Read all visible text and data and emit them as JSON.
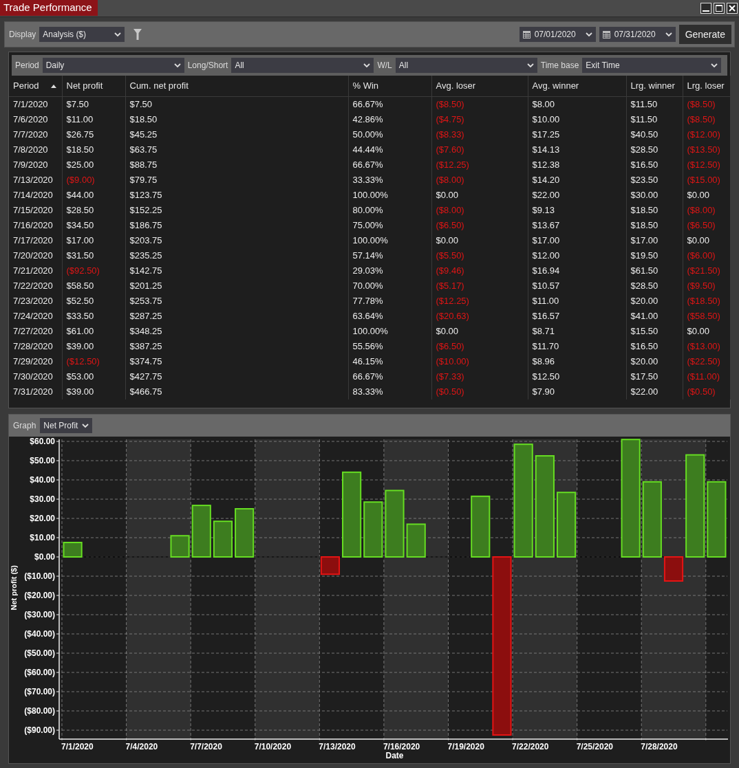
{
  "window": {
    "title": "Trade Performance"
  },
  "toolbar": {
    "display_label": "Display",
    "display_value": "Analysis ($)",
    "start_date": "07/01/2020",
    "end_date": "07/31/2020",
    "generate": "Generate"
  },
  "filters": [
    {
      "label": "Period",
      "value": "Daily"
    },
    {
      "label": "Long/Short",
      "value": "All"
    },
    {
      "label": "W/L",
      "value": "All"
    },
    {
      "label": "Time base",
      "value": "Exit Time"
    }
  ],
  "table": {
    "columns": [
      {
        "label": "Period",
        "sorted": true
      },
      {
        "label": "Net profit",
        "sorted": false
      },
      {
        "label": "Cum. net profit",
        "sorted": false
      },
      {
        "label": "% Win",
        "sorted": false
      },
      {
        "label": "Avg. loser",
        "sorted": false
      },
      {
        "label": "Avg. winner",
        "sorted": false
      },
      {
        "label": "Lrg. winner",
        "sorted": false
      },
      {
        "label": "Lrg. loser",
        "sorted": false
      }
    ],
    "rows": [
      {
        "cells": [
          "7/1/2020",
          "$7.50",
          "$7.50",
          "66.67%",
          "($8.50)",
          "$8.00",
          "$11.50",
          "($8.50)"
        ],
        "negative": [
          false,
          false,
          false,
          false,
          true,
          false,
          false,
          true
        ]
      },
      {
        "cells": [
          "7/6/2020",
          "$11.00",
          "$18.50",
          "42.86%",
          "($4.75)",
          "$10.00",
          "$11.50",
          "($8.50)"
        ],
        "negative": [
          false,
          false,
          false,
          false,
          true,
          false,
          false,
          true
        ]
      },
      {
        "cells": [
          "7/7/2020",
          "$26.75",
          "$45.25",
          "50.00%",
          "($8.33)",
          "$17.25",
          "$40.50",
          "($12.00)"
        ],
        "negative": [
          false,
          false,
          false,
          false,
          true,
          false,
          false,
          true
        ]
      },
      {
        "cells": [
          "7/8/2020",
          "$18.50",
          "$63.75",
          "44.44%",
          "($7.60)",
          "$14.13",
          "$28.50",
          "($13.50)"
        ],
        "negative": [
          false,
          false,
          false,
          false,
          true,
          false,
          false,
          true
        ]
      },
      {
        "cells": [
          "7/9/2020",
          "$25.00",
          "$88.75",
          "66.67%",
          "($12.25)",
          "$12.38",
          "$16.50",
          "($12.50)"
        ],
        "negative": [
          false,
          false,
          false,
          false,
          true,
          false,
          false,
          true
        ]
      },
      {
        "cells": [
          "7/13/2020",
          "($9.00)",
          "$79.75",
          "33.33%",
          "($8.00)",
          "$14.20",
          "$23.50",
          "($15.00)"
        ],
        "negative": [
          false,
          true,
          false,
          false,
          true,
          false,
          false,
          true
        ]
      },
      {
        "cells": [
          "7/14/2020",
          "$44.00",
          "$123.75",
          "100.00%",
          "$0.00",
          "$22.00",
          "$30.00",
          "$0.00"
        ],
        "negative": [
          false,
          false,
          false,
          false,
          false,
          false,
          false,
          false
        ]
      },
      {
        "cells": [
          "7/15/2020",
          "$28.50",
          "$152.25",
          "80.00%",
          "($8.00)",
          "$9.13",
          "$18.50",
          "($8.00)"
        ],
        "negative": [
          false,
          false,
          false,
          false,
          true,
          false,
          false,
          true
        ]
      },
      {
        "cells": [
          "7/16/2020",
          "$34.50",
          "$186.75",
          "75.00%",
          "($6.50)",
          "$13.67",
          "$18.50",
          "($6.50)"
        ],
        "negative": [
          false,
          false,
          false,
          false,
          true,
          false,
          false,
          true
        ]
      },
      {
        "cells": [
          "7/17/2020",
          "$17.00",
          "$203.75",
          "100.00%",
          "$0.00",
          "$17.00",
          "$17.00",
          "$0.00"
        ],
        "negative": [
          false,
          false,
          false,
          false,
          false,
          false,
          false,
          false
        ]
      },
      {
        "cells": [
          "7/20/2020",
          "$31.50",
          "$235.25",
          "57.14%",
          "($5.50)",
          "$12.00",
          "$19.50",
          "($6.00)"
        ],
        "negative": [
          false,
          false,
          false,
          false,
          true,
          false,
          false,
          true
        ]
      },
      {
        "cells": [
          "7/21/2020",
          "($92.50)",
          "$142.75",
          "29.03%",
          "($9.46)",
          "$16.94",
          "$61.50",
          "($21.50)"
        ],
        "negative": [
          false,
          true,
          false,
          false,
          true,
          false,
          false,
          true
        ]
      },
      {
        "cells": [
          "7/22/2020",
          "$58.50",
          "$201.25",
          "70.00%",
          "($5.17)",
          "$10.57",
          "$28.50",
          "($9.50)"
        ],
        "negative": [
          false,
          false,
          false,
          false,
          true,
          false,
          false,
          true
        ]
      },
      {
        "cells": [
          "7/23/2020",
          "$52.50",
          "$253.75",
          "77.78%",
          "($12.25)",
          "$11.00",
          "$20.00",
          "($18.50)"
        ],
        "negative": [
          false,
          false,
          false,
          false,
          true,
          false,
          false,
          true
        ]
      },
      {
        "cells": [
          "7/24/2020",
          "$33.50",
          "$287.25",
          "63.64%",
          "($20.63)",
          "$16.57",
          "$41.00",
          "($58.50)"
        ],
        "negative": [
          false,
          false,
          false,
          false,
          true,
          false,
          false,
          true
        ]
      },
      {
        "cells": [
          "7/27/2020",
          "$61.00",
          "$348.25",
          "100.00%",
          "$0.00",
          "$8.71",
          "$15.50",
          "$0.00"
        ],
        "negative": [
          false,
          false,
          false,
          false,
          false,
          false,
          false,
          false
        ]
      },
      {
        "cells": [
          "7/28/2020",
          "$39.00",
          "$387.25",
          "55.56%",
          "($6.50)",
          "$11.70",
          "$16.50",
          "($13.00)"
        ],
        "negative": [
          false,
          false,
          false,
          false,
          true,
          false,
          false,
          true
        ]
      },
      {
        "cells": [
          "7/29/2020",
          "($12.50)",
          "$374.75",
          "46.15%",
          "($10.00)",
          "$8.96",
          "$20.00",
          "($22.50)"
        ],
        "negative": [
          false,
          true,
          false,
          false,
          true,
          false,
          false,
          true
        ]
      },
      {
        "cells": [
          "7/30/2020",
          "$53.00",
          "$427.75",
          "66.67%",
          "($7.33)",
          "$12.50",
          "$17.50",
          "($11.00)"
        ],
        "negative": [
          false,
          false,
          false,
          false,
          true,
          false,
          false,
          true
        ]
      },
      {
        "cells": [
          "7/31/2020",
          "$39.00",
          "$466.75",
          "83.33%",
          "($0.50)",
          "$7.90",
          "$22.00",
          "($0.50)"
        ],
        "negative": [
          false,
          false,
          false,
          false,
          true,
          false,
          false,
          true
        ]
      }
    ]
  },
  "graph": {
    "label": "Graph",
    "selector": "Net Profit",
    "chart_data": {
      "type": "bar",
      "xlabel": "Date",
      "ylabel": "Net profit ($)",
      "categories": [
        "7/1/2020",
        null,
        null,
        "7/4/2020",
        null,
        null,
        "7/7/2020",
        null,
        null,
        "7/10/2020",
        null,
        null,
        "7/13/2020",
        null,
        null,
        "7/16/2020",
        null,
        null,
        "7/19/2020",
        null,
        null,
        "7/22/2020",
        null,
        null,
        "7/25/2020",
        null,
        null,
        "7/28/2020",
        null,
        null,
        null
      ],
      "series": [
        {
          "color": "#3d7d1f",
          "values": [
            7.5,
            null,
            null,
            null,
            null,
            11,
            26.75,
            18.5,
            25,
            null,
            null,
            null,
            null,
            44,
            28.5,
            34.5,
            17,
            null,
            null,
            31.5,
            null,
            58.5,
            52.5,
            33.5,
            null,
            null,
            61,
            39,
            null,
            53,
            39
          ]
        },
        {
          "color": "#8c0e0e",
          "values": [
            null,
            null,
            null,
            null,
            null,
            null,
            null,
            null,
            null,
            null,
            null,
            null,
            -9,
            null,
            null,
            null,
            null,
            null,
            null,
            null,
            -92.5,
            null,
            null,
            null,
            null,
            null,
            null,
            null,
            -12.5,
            null,
            null
          ]
        }
      ],
      "ylim": [
        -93,
        61
      ],
      "grid": true,
      "yticks": [
        {
          "value": 60,
          "label": "$60.00"
        },
        {
          "value": 50,
          "label": "$50.00"
        },
        {
          "value": 40,
          "label": "$40.00"
        },
        {
          "value": 30,
          "label": "$30.00"
        },
        {
          "value": 20,
          "label": "$20.00"
        },
        {
          "value": 10,
          "label": "$10.00"
        },
        {
          "value": 0,
          "label": "$0.00"
        },
        {
          "value": -10,
          "label": "($10.00)"
        },
        {
          "value": -20,
          "label": "($20.00)"
        },
        {
          "value": -30,
          "label": "($30.00)"
        },
        {
          "value": -40,
          "label": "($40.00)"
        },
        {
          "value": -50,
          "label": "($50.00)"
        },
        {
          "value": -60,
          "label": "($60.00)"
        },
        {
          "value": -70,
          "label": "($70.00)"
        },
        {
          "value": -80,
          "label": "($80.00)"
        },
        {
          "value": -90,
          "label": "($90.00)"
        }
      ]
    }
  }
}
